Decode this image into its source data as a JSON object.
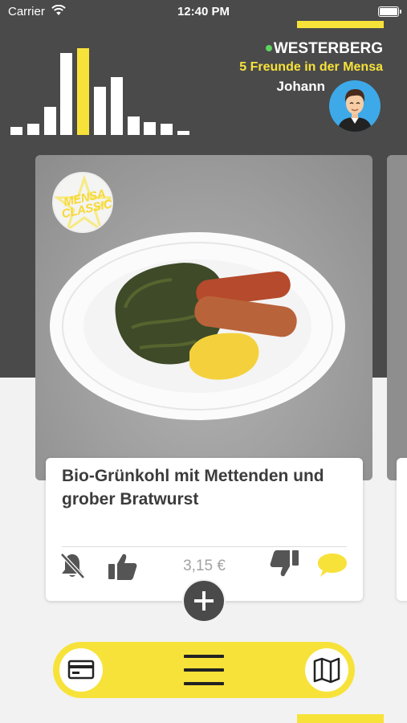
{
  "status_bar": {
    "carrier": "Carrier",
    "time": "12:40 PM"
  },
  "header": {
    "mensa_name": "WESTERBERG",
    "friends_text": "5 Freunde in der Mensa",
    "user_name": "Johann"
  },
  "occupancy_levels": [
    0.09,
    0.12,
    0.31,
    0.9,
    0.96,
    0.53,
    0.64,
    0.2,
    0.14,
    0.12,
    0.04
  ],
  "occupancy_current_index": 4,
  "meal": {
    "badge_line1": "MENSA",
    "badge_line2": "CLASSIC",
    "title": "Bio-Grünkohl mit Mettenden und grober Bratwurst",
    "price": "3,15 €"
  },
  "colors": {
    "accent": "#f7e23a",
    "dark": "#4a4a4a",
    "online": "#5fd35f"
  },
  "icons": {
    "mute": "bell-slash-icon",
    "like": "thumbs-up-icon",
    "dislike": "thumbs-down-icon",
    "comment": "chat-bubble-icon",
    "add": "plus-icon",
    "card": "credit-card-icon",
    "menu": "hamburger-menu-icon",
    "map": "map-icon"
  }
}
